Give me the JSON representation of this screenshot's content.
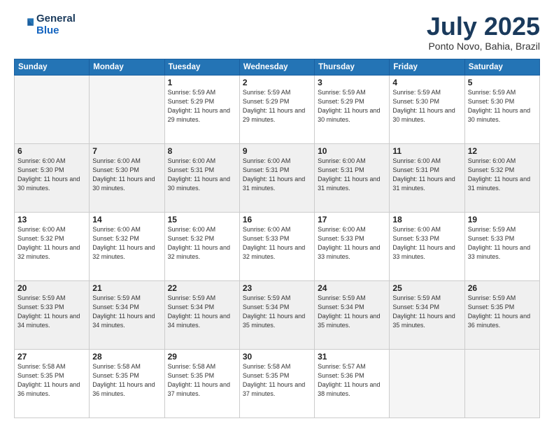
{
  "header": {
    "logo_line1": "General",
    "logo_line2": "Blue",
    "month": "July 2025",
    "location": "Ponto Novo, Bahia, Brazil"
  },
  "days_of_week": [
    "Sunday",
    "Monday",
    "Tuesday",
    "Wednesday",
    "Thursday",
    "Friday",
    "Saturday"
  ],
  "weeks": [
    [
      {
        "day": "",
        "text": ""
      },
      {
        "day": "",
        "text": ""
      },
      {
        "day": "1",
        "text": "Sunrise: 5:59 AM\nSunset: 5:29 PM\nDaylight: 11 hours and 29 minutes."
      },
      {
        "day": "2",
        "text": "Sunrise: 5:59 AM\nSunset: 5:29 PM\nDaylight: 11 hours and 29 minutes."
      },
      {
        "day": "3",
        "text": "Sunrise: 5:59 AM\nSunset: 5:29 PM\nDaylight: 11 hours and 30 minutes."
      },
      {
        "day": "4",
        "text": "Sunrise: 5:59 AM\nSunset: 5:30 PM\nDaylight: 11 hours and 30 minutes."
      },
      {
        "day": "5",
        "text": "Sunrise: 5:59 AM\nSunset: 5:30 PM\nDaylight: 11 hours and 30 minutes."
      }
    ],
    [
      {
        "day": "6",
        "text": "Sunrise: 6:00 AM\nSunset: 5:30 PM\nDaylight: 11 hours and 30 minutes."
      },
      {
        "day": "7",
        "text": "Sunrise: 6:00 AM\nSunset: 5:30 PM\nDaylight: 11 hours and 30 minutes."
      },
      {
        "day": "8",
        "text": "Sunrise: 6:00 AM\nSunset: 5:31 PM\nDaylight: 11 hours and 30 minutes."
      },
      {
        "day": "9",
        "text": "Sunrise: 6:00 AM\nSunset: 5:31 PM\nDaylight: 11 hours and 31 minutes."
      },
      {
        "day": "10",
        "text": "Sunrise: 6:00 AM\nSunset: 5:31 PM\nDaylight: 11 hours and 31 minutes."
      },
      {
        "day": "11",
        "text": "Sunrise: 6:00 AM\nSunset: 5:31 PM\nDaylight: 11 hours and 31 minutes."
      },
      {
        "day": "12",
        "text": "Sunrise: 6:00 AM\nSunset: 5:32 PM\nDaylight: 11 hours and 31 minutes."
      }
    ],
    [
      {
        "day": "13",
        "text": "Sunrise: 6:00 AM\nSunset: 5:32 PM\nDaylight: 11 hours and 32 minutes."
      },
      {
        "day": "14",
        "text": "Sunrise: 6:00 AM\nSunset: 5:32 PM\nDaylight: 11 hours and 32 minutes."
      },
      {
        "day": "15",
        "text": "Sunrise: 6:00 AM\nSunset: 5:32 PM\nDaylight: 11 hours and 32 minutes."
      },
      {
        "day": "16",
        "text": "Sunrise: 6:00 AM\nSunset: 5:33 PM\nDaylight: 11 hours and 32 minutes."
      },
      {
        "day": "17",
        "text": "Sunrise: 6:00 AM\nSunset: 5:33 PM\nDaylight: 11 hours and 33 minutes."
      },
      {
        "day": "18",
        "text": "Sunrise: 6:00 AM\nSunset: 5:33 PM\nDaylight: 11 hours and 33 minutes."
      },
      {
        "day": "19",
        "text": "Sunrise: 5:59 AM\nSunset: 5:33 PM\nDaylight: 11 hours and 33 minutes."
      }
    ],
    [
      {
        "day": "20",
        "text": "Sunrise: 5:59 AM\nSunset: 5:33 PM\nDaylight: 11 hours and 34 minutes."
      },
      {
        "day": "21",
        "text": "Sunrise: 5:59 AM\nSunset: 5:34 PM\nDaylight: 11 hours and 34 minutes."
      },
      {
        "day": "22",
        "text": "Sunrise: 5:59 AM\nSunset: 5:34 PM\nDaylight: 11 hours and 34 minutes."
      },
      {
        "day": "23",
        "text": "Sunrise: 5:59 AM\nSunset: 5:34 PM\nDaylight: 11 hours and 35 minutes."
      },
      {
        "day": "24",
        "text": "Sunrise: 5:59 AM\nSunset: 5:34 PM\nDaylight: 11 hours and 35 minutes."
      },
      {
        "day": "25",
        "text": "Sunrise: 5:59 AM\nSunset: 5:34 PM\nDaylight: 11 hours and 35 minutes."
      },
      {
        "day": "26",
        "text": "Sunrise: 5:59 AM\nSunset: 5:35 PM\nDaylight: 11 hours and 36 minutes."
      }
    ],
    [
      {
        "day": "27",
        "text": "Sunrise: 5:58 AM\nSunset: 5:35 PM\nDaylight: 11 hours and 36 minutes."
      },
      {
        "day": "28",
        "text": "Sunrise: 5:58 AM\nSunset: 5:35 PM\nDaylight: 11 hours and 36 minutes."
      },
      {
        "day": "29",
        "text": "Sunrise: 5:58 AM\nSunset: 5:35 PM\nDaylight: 11 hours and 37 minutes."
      },
      {
        "day": "30",
        "text": "Sunrise: 5:58 AM\nSunset: 5:35 PM\nDaylight: 11 hours and 37 minutes."
      },
      {
        "day": "31",
        "text": "Sunrise: 5:57 AM\nSunset: 5:36 PM\nDaylight: 11 hours and 38 minutes."
      },
      {
        "day": "",
        "text": ""
      },
      {
        "day": "",
        "text": ""
      }
    ]
  ]
}
